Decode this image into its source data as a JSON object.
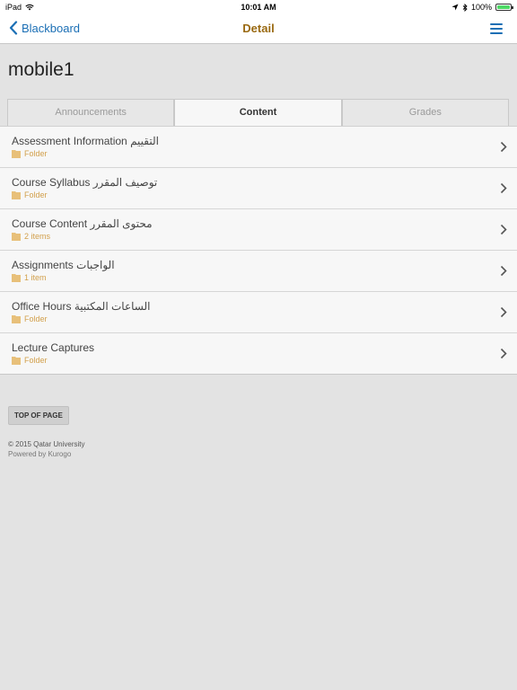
{
  "status_bar": {
    "device": "iPad",
    "time": "10:01 AM",
    "battery": "100%"
  },
  "nav": {
    "back_label": "Blackboard",
    "title": "Detail"
  },
  "page": {
    "title": "mobile1"
  },
  "tabs": [
    {
      "label": "Announcements",
      "active": false
    },
    {
      "label": "Content",
      "active": true
    },
    {
      "label": "Grades",
      "active": false
    }
  ],
  "items": [
    {
      "title": "Assessment Information التقييم",
      "subtitle": "Folder"
    },
    {
      "title": "Course Syllabus توصيف المقرر",
      "subtitle": "Folder"
    },
    {
      "title": "Course Content محتوى المقرر",
      "subtitle": "2 items"
    },
    {
      "title": "Assignments الواجبات",
      "subtitle": "1 item"
    },
    {
      "title": "Office Hours الساعات المكتبية",
      "subtitle": "Folder"
    },
    {
      "title": "Lecture Captures",
      "subtitle": "Folder"
    }
  ],
  "footer": {
    "top_button": "TOP OF PAGE",
    "copyright": "© 2015 Qatar University",
    "powered": "Powered by Kurogo"
  },
  "colors": {
    "accent_blue": "#1b6fb5",
    "title_gold": "#9a6a12",
    "folder_tan": "#d2a04c"
  }
}
